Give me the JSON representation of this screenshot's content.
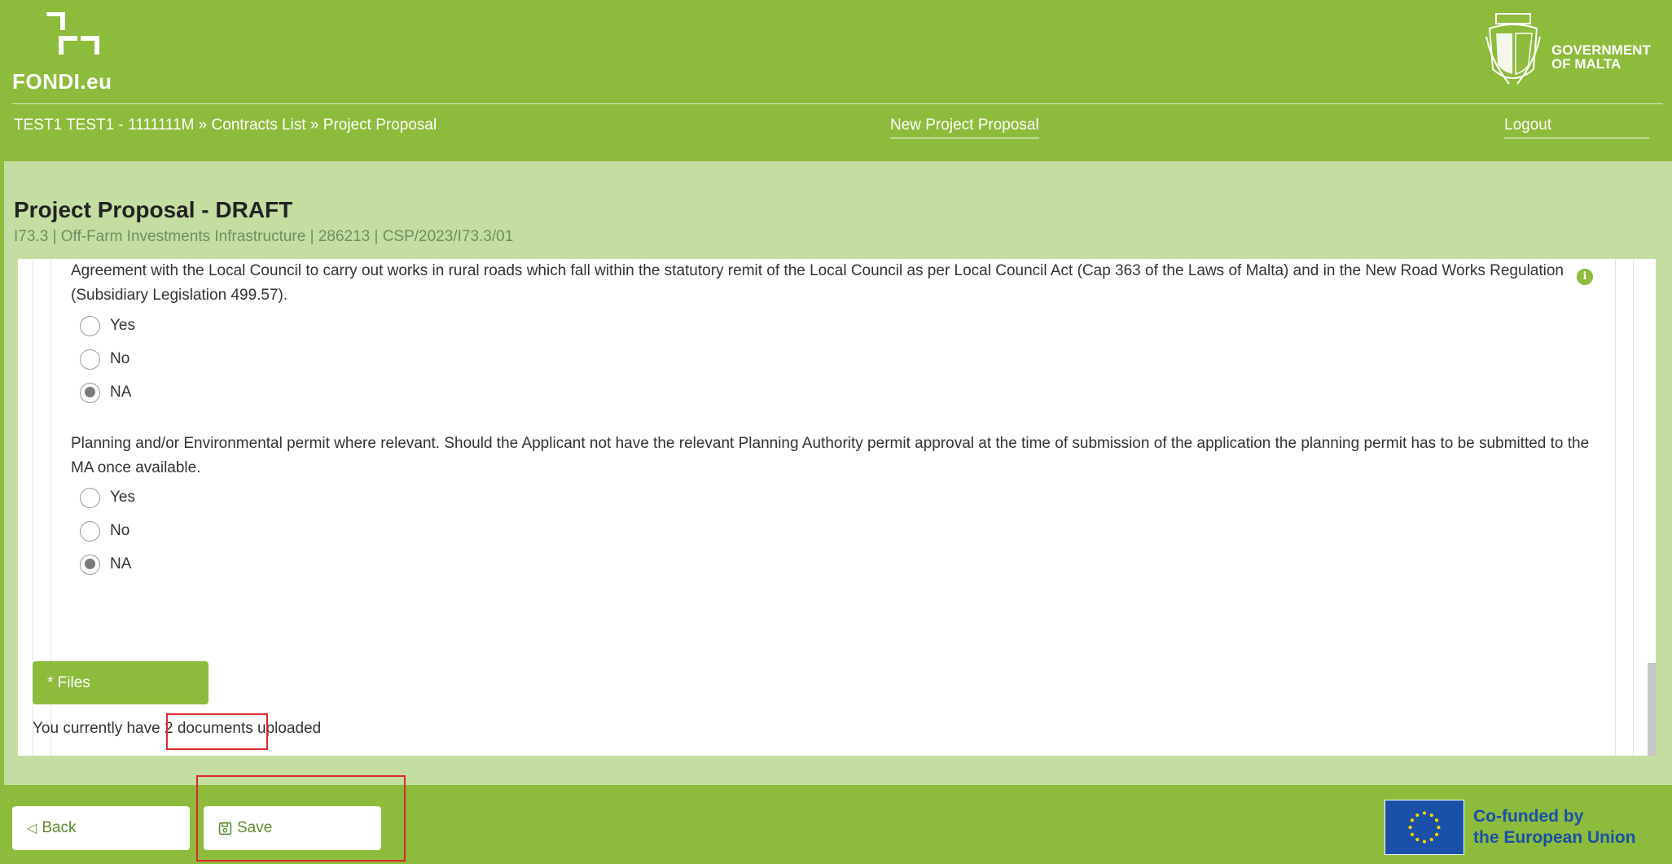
{
  "header": {
    "logo_text": "FONDI.eu",
    "gov_line1": "GOVERNMENT",
    "gov_line2": "OF MALTA",
    "breadcrumb": "TEST1 TEST1 - 1111111M » Contracts List » Project Proposal",
    "new_proposal_link": "New Project Proposal",
    "logout_link": "Logout"
  },
  "page": {
    "title": "Project Proposal - DRAFT",
    "subtitle": "I73.3 | Off-Farm Investments Infrastructure | 286213 | CSP/2023/I73.3/01"
  },
  "questions": [
    {
      "text": "Agreement with the Local Council to carry out works in rural roads which fall within the statutory remit of the Local Council as per Local Council Act (Cap 363 of the Laws of Malta) and in the New Road Works Regulation (Subsidiary Legislation 499.57).",
      "options": [
        "Yes",
        "No",
        "NA"
      ],
      "selected": "NA"
    },
    {
      "text": "Planning and/or Environmental permit where relevant. Should the Applicant not have the relevant Planning Authority permit approval at the time of submission of the application the planning permit has to be submitted to the MA once available.",
      "options": [
        "Yes",
        "No",
        "NA"
      ],
      "selected": "NA"
    }
  ],
  "files": {
    "button_label": "* Files",
    "doc_prefix": "You currently have ",
    "doc_count": "2 documents",
    "doc_suffix": " uploaded"
  },
  "footer": {
    "back_label": "Back",
    "save_label": "Save",
    "eu_line1": "Co-funded by",
    "eu_line2": "the European Union"
  },
  "colors": {
    "brand_green": "#8dbb3b",
    "light_band": "#c4dea1",
    "highlight_red": "#e0262b",
    "eu_blue": "#1a50a8"
  }
}
